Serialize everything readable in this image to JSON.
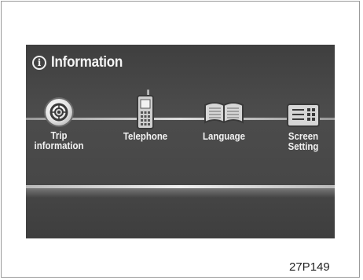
{
  "header": {
    "title": "Information",
    "info_icon": "info-circle-icon"
  },
  "menu": {
    "items": [
      {
        "id": "trip",
        "label_lines": [
          "Trip",
          "information"
        ],
        "icon": "tire-wheel-icon"
      },
      {
        "id": "telephone",
        "label_lines": [
          "Telephone"
        ],
        "icon": "cell-phone-icon"
      },
      {
        "id": "language",
        "label_lines": [
          "Language"
        ],
        "icon": "open-book-icon"
      },
      {
        "id": "screen",
        "label_lines": [
          "Screen",
          "Setting"
        ],
        "icon": "screen-settings-icon"
      }
    ]
  },
  "caption": "27P149",
  "colors": {
    "screen_bg": "#474747",
    "text": "#f2f2f2",
    "accent_line": "#dedede"
  }
}
